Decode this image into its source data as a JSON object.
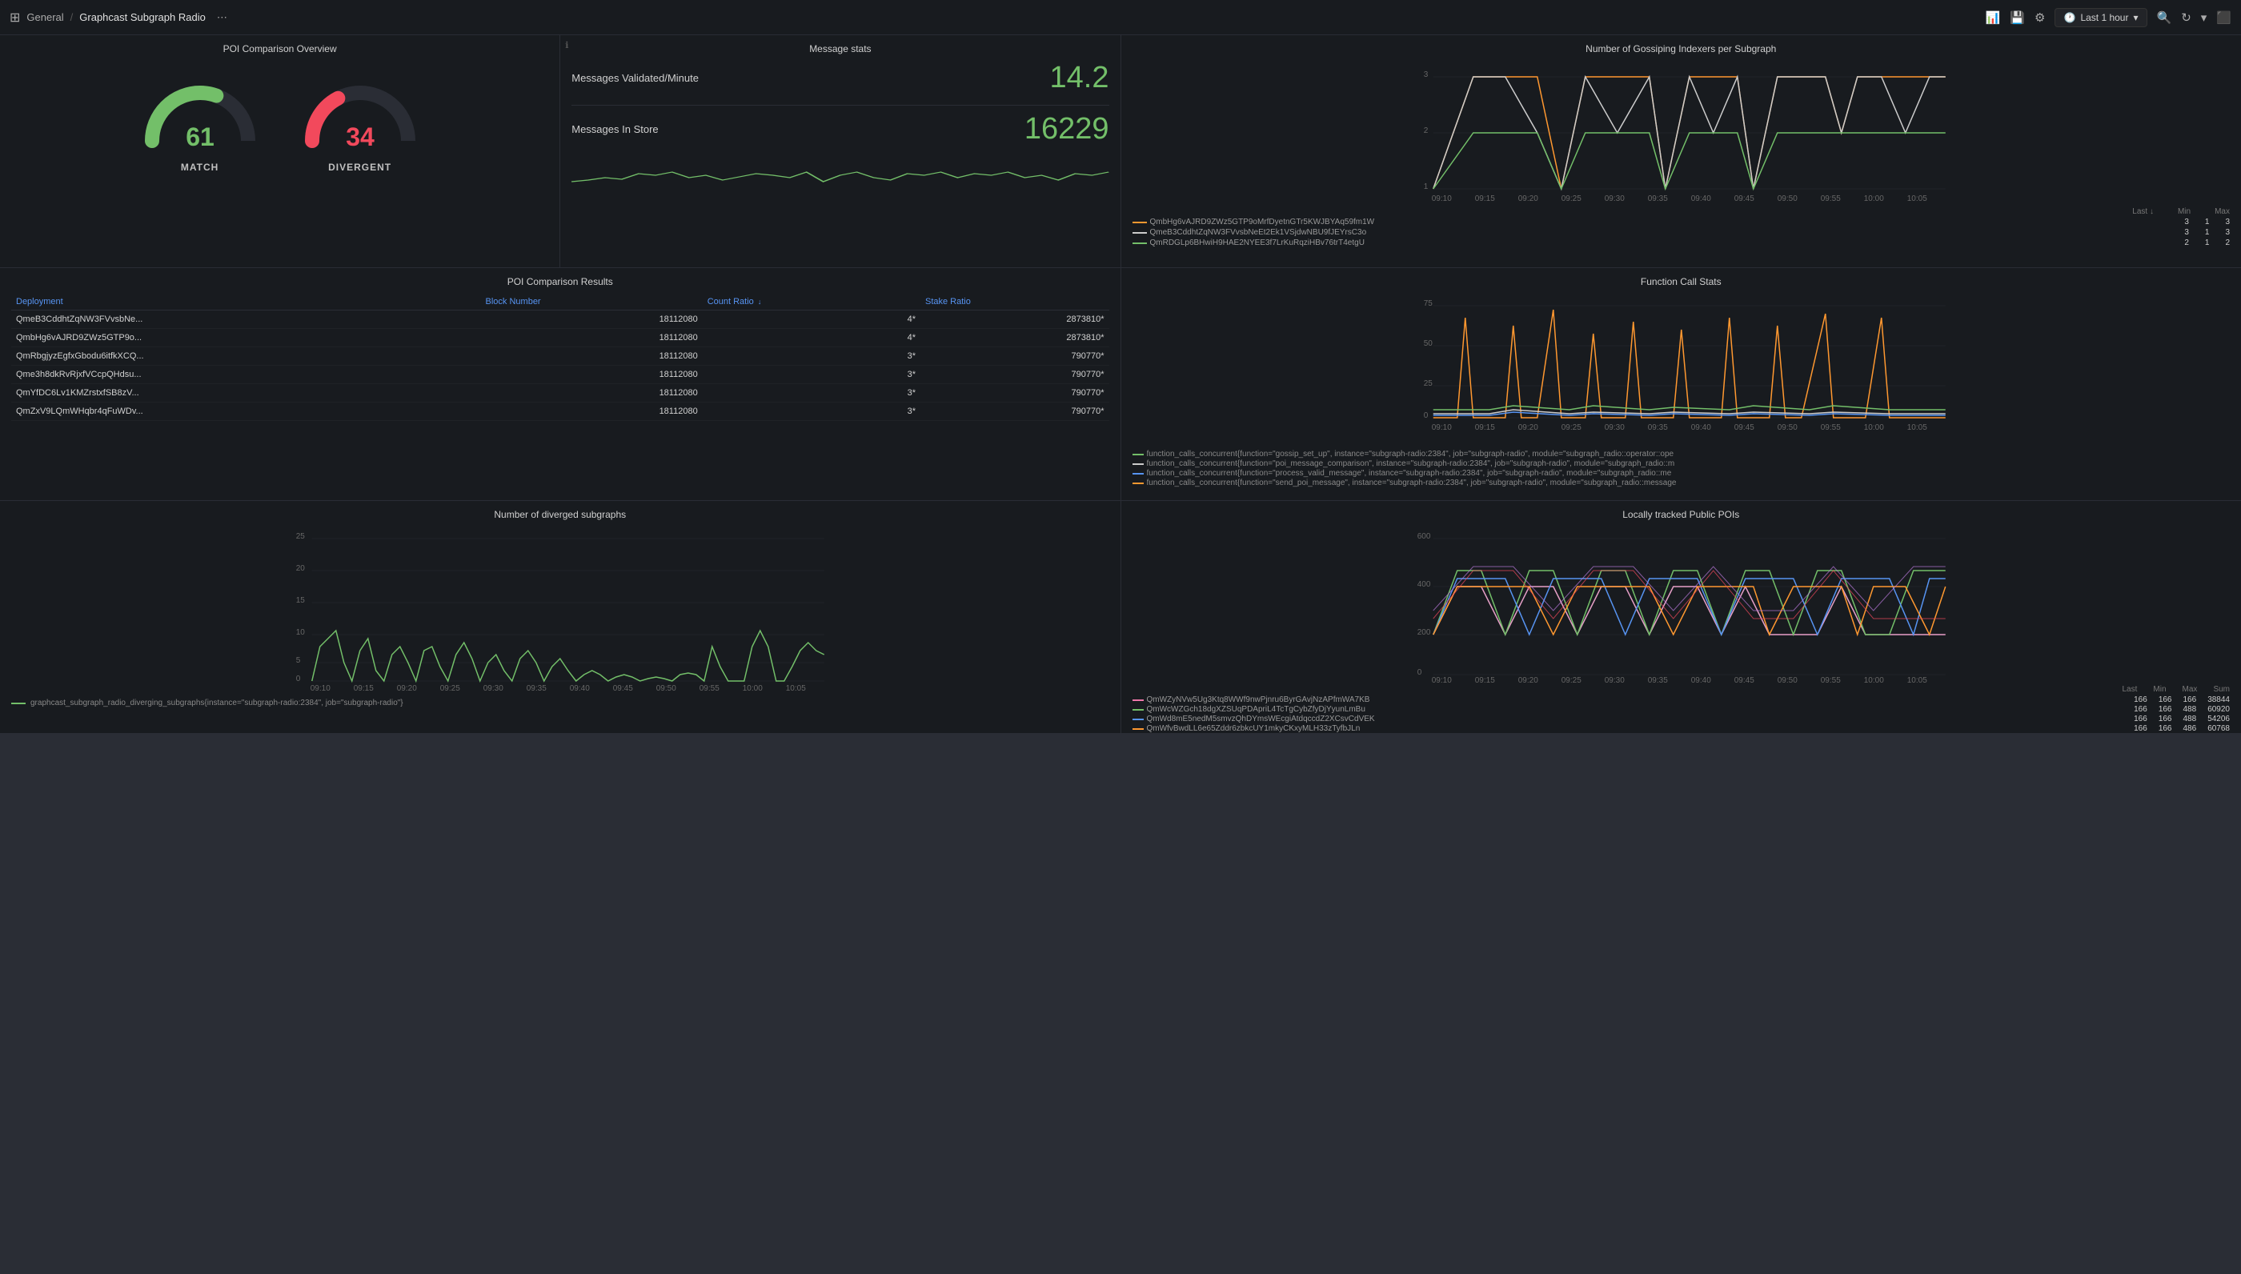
{
  "topbar": {
    "app_icon": "⊞",
    "breadcrumb": "General",
    "separator": "/",
    "title": "Graphcast Subgraph Radio",
    "share_icon": "⋯",
    "time_range": "Last 1 hour",
    "icons": [
      "bar-chart",
      "save",
      "settings",
      "clock",
      "zoom-out",
      "refresh",
      "chevron-down",
      "tv"
    ]
  },
  "panels": {
    "poi_overview": {
      "title": "POI Comparison Overview",
      "match_value": 61,
      "match_label": "MATCH",
      "divergent_value": 34,
      "divergent_label": "DIVERGENT"
    },
    "message_stats": {
      "title": "Message stats",
      "validated_label": "Messages Validated/Minute",
      "validated_value": "14.2",
      "store_label": "Messages In Store",
      "store_value": "16229"
    },
    "poi_results": {
      "title": "POI Comparison Results",
      "columns": [
        "Deployment",
        "Block Number",
        "Count Ratio ↓",
        "Stake Ratio"
      ],
      "rows": [
        {
          "deployment": "QmeB3CddhtZqNW3FVvsbNe...",
          "block": "18112080",
          "count": "4*",
          "stake": "2873810*"
        },
        {
          "deployment": "QmbHg6vAJRD9ZWz5GTP9o...",
          "block": "18112080",
          "count": "4*",
          "stake": "2873810*"
        },
        {
          "deployment": "QmRbgjyzEgfxGbodu6itfkXCQ...",
          "block": "18112080",
          "count": "3*",
          "stake": "790770*"
        },
        {
          "deployment": "Qme3h8dkRvRjxfVCcpQHdsu...",
          "block": "18112080",
          "count": "3*",
          "stake": "790770*"
        },
        {
          "deployment": "QmYfDC6Lv1KMZrstxfSB8zV...",
          "block": "18112080",
          "count": "3*",
          "stake": "790770*"
        },
        {
          "deployment": "QmZxV9LQmWHqbr4qFuWDv...",
          "block": "18112080",
          "count": "3*",
          "stake": "790770*"
        }
      ]
    },
    "gossiping": {
      "title": "Number of Gossiping Indexers per Subgraph",
      "y_max": 3,
      "x_labels": [
        "09:10",
        "09:15",
        "09:20",
        "09:25",
        "09:30",
        "09:35",
        "09:40",
        "09:45",
        "09:50",
        "09:55",
        "10:00",
        "10:05"
      ],
      "legend": [
        {
          "label": "QmbHg6vAJRD9ZWz5GTP9oMrfDyetnGTr5KWJBYAq59fm1W",
          "color": "#ff9830",
          "last": "3",
          "min": "1",
          "max": "3"
        },
        {
          "label": "QmeB3CddhtZqNW3FVvsbNeEt2Ek1VSjdwNBU9fJEYrsC3o",
          "color": "#ccc",
          "last": "3",
          "min": "1",
          "max": "3"
        },
        {
          "label": "QmRDGLp6BHwiH9HAE2NYEE3f7LrKuRqziHBv76trT4etgU",
          "color": "#73bf69",
          "last": "2",
          "min": "1",
          "max": "2"
        }
      ],
      "col_headers": [
        "Last ↓",
        "Min",
        "Max"
      ]
    },
    "function_calls": {
      "title": "Function Call Stats",
      "y_max": 75,
      "y_labels": [
        "75",
        "50",
        "25",
        "0"
      ],
      "x_labels": [
        "09:10",
        "09:15",
        "09:20",
        "09:25",
        "09:30",
        "09:35",
        "09:40",
        "09:45",
        "09:50",
        "09:55",
        "10:00",
        "10:05"
      ],
      "legend": [
        {
          "label": "function_calls_concurrent{function=\"gossip_set_up\", instance=\"subgraph-radio:2384\", job=\"subgraph-radio\", module=\"subgraph_radio::operator::ope",
          "color": "#73bf69"
        },
        {
          "label": "function_calls_concurrent{function=\"poi_message_comparison\", instance=\"subgraph-radio:2384\", job=\"subgraph-radio\", module=\"subgraph_radio::m",
          "color": "#ccc"
        },
        {
          "label": "function_calls_concurrent{function=\"process_valid_message\", instance=\"subgraph-radio:2384\", job=\"subgraph-radio\", module=\"subgraph_radio::me",
          "color": "#5794f2"
        },
        {
          "label": "function_calls_concurrent{function=\"send_poi_message\", instance=\"subgraph-radio:2384\", job=\"subgraph-radio\", module=\"subgraph_radio::message",
          "color": "#ff9830"
        }
      ]
    },
    "diverged": {
      "title": "Number of diverged subgraphs",
      "y_max": 25,
      "y_labels": [
        "25",
        "20",
        "15",
        "10",
        "5",
        "0"
      ],
      "x_labels": [
        "09:10",
        "09:15",
        "09:20",
        "09:25",
        "09:30",
        "09:35",
        "09:40",
        "09:45",
        "09:50",
        "09:55",
        "10:00",
        "10:05"
      ],
      "legend_label": "graphcast_subgraph_radio_diverging_subgraphs{instance=\"subgraph-radio:2384\", job=\"subgraph-radio\"}",
      "legend_color": "#73bf69"
    },
    "public_pois": {
      "title": "Locally tracked Public POIs",
      "y_max": 600,
      "y_labels": [
        "600",
        "400",
        "200",
        "0"
      ],
      "x_labels": [
        "09:10",
        "09:15",
        "09:20",
        "09:25",
        "09:30",
        "09:35",
        "09:40",
        "09:45",
        "09:50",
        "09:55",
        "10:00",
        "10:05"
      ],
      "legend": [
        {
          "label": "QmWZyNVw5Ug3Ktq8WWf9nwPjnru6ByrGAvjNzAPfmWA7KB",
          "color": "#e7a",
          "last": "166",
          "min": "166",
          "max": "166",
          "sum": "38844"
        },
        {
          "label": "QmWcWZGch18dgXZSUqPDApriL4TcTgCybZfyDjYyunLmBu",
          "color": "#73bf69",
          "last": "166",
          "min": "166",
          "max": "488",
          "sum": "60920"
        },
        {
          "label": "QmWd8mE5nedM5smvzQhDYmsWEcgiAtdqccdZ2XCsvCdVEK",
          "color": "#5794f2",
          "last": "166",
          "min": "166",
          "max": "488",
          "sum": "54206"
        },
        {
          "label": "QmWfvBwdLL6e65Zddr6zbkcUY1mkyCKxyMLH33zTyfbJLn",
          "color": "#ff9830",
          "last": "166",
          "min": "166",
          "max": "486",
          "sum": "60768"
        }
      ],
      "col_headers": [
        "Last",
        "Min",
        "Max",
        "Sum"
      ]
    }
  }
}
